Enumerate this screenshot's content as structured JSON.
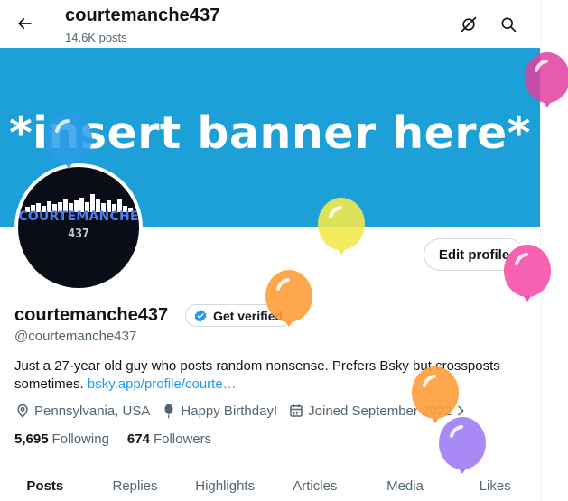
{
  "header": {
    "title": "courtemanche437",
    "post_count": "14.6K posts",
    "back_icon": "arrow-left-icon",
    "grok_icon": "grok-icon",
    "search_icon": "search-icon"
  },
  "banner": {
    "text": "*insert banner here*",
    "color": "#1d9fd8"
  },
  "avatar": {
    "logo_line1": "COURTEMANCHE",
    "logo_line2": "437"
  },
  "profile": {
    "edit_label": "Edit profile",
    "display_name": "courtemanche437",
    "verify_label": "Get verified",
    "handle": "@courtemanche437",
    "bio_text": "Just a 27-year old guy who posts random nonsense. Prefers Bsky but crossposts sometimes.",
    "bio_link": "bsky.app/profile/courte…",
    "location": "Pennsylvania, USA",
    "birthday": "Happy Birthday!",
    "joined": "Joined September 2022",
    "following_count": "5,695",
    "following_label": "Following",
    "followers_count": "674",
    "followers_label": "Followers"
  },
  "tabs": [
    {
      "label": "Posts",
      "active": true
    },
    {
      "label": "Replies",
      "active": false
    },
    {
      "label": "Highlights",
      "active": false
    },
    {
      "label": "Articles",
      "active": false
    },
    {
      "label": "Media",
      "active": false
    },
    {
      "label": "Likes",
      "active": false
    }
  ],
  "colors": {
    "accent": "#1d9bf0",
    "balloon_blue": "#2a9be6",
    "balloon_yellow": "#f2e94e",
    "balloon_orange": "#ff9d3a",
    "balloon_pink": "#f550a8",
    "balloon_purple": "#a07cf5",
    "balloon_magenta": "#e040a0"
  }
}
